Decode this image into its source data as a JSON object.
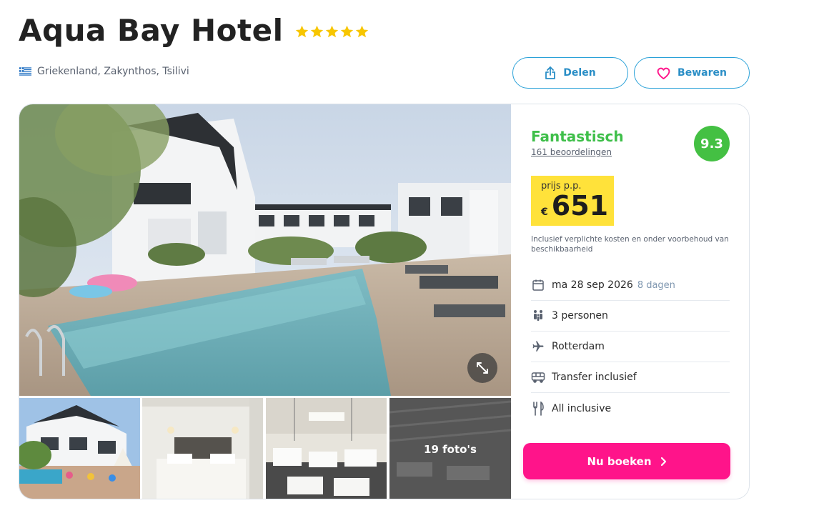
{
  "hotel": {
    "name": "Aqua Bay Hotel",
    "stars": 5,
    "location": "Griekenland, Zakynthos, Tsilivi"
  },
  "actions": {
    "share_label": "Delen",
    "save_label": "Bewaren"
  },
  "gallery": {
    "more_photos_label": "19 foto's"
  },
  "rating": {
    "word": "Fantastisch",
    "reviews": "161 beoordelingen",
    "score": "9.3"
  },
  "price": {
    "label": "prijs p.p.",
    "currency": "€",
    "amount": "651",
    "disclaimer": "Inclusief verplichte kosten en onder voorbehoud van beschikbaarheid"
  },
  "details": {
    "date": "ma 28 sep 2026",
    "duration": "8 dagen",
    "persons": "3 personen",
    "departure": "Rotterdam",
    "transfer": "Transfer inclusief",
    "board": "All inclusive"
  },
  "booking": {
    "button_label": "Nu boeken"
  },
  "colors": {
    "accent_blue": "#2aa1d8",
    "rating_green": "#3fbf4a",
    "price_yellow": "#ffe23a",
    "book_pink": "#ff148a",
    "star_gold": "#f7c600"
  },
  "icons": {
    "flag": "greece-flag-icon",
    "share": "share-icon",
    "save": "heart-icon",
    "expand": "expand-icon",
    "date": "calendar-icon",
    "persons": "people-icon",
    "departure": "plane-icon",
    "transfer": "bus-icon",
    "board": "cutlery-icon",
    "book": "chevron-right-icon"
  }
}
